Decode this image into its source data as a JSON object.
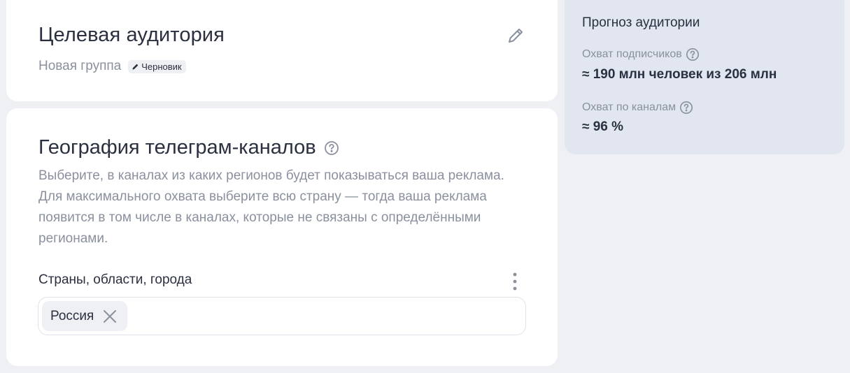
{
  "audience_card": {
    "title": "Целевая аудитория",
    "group_name": "Новая группа",
    "draft_badge": "Черновик",
    "edit_icon": "pencil-icon"
  },
  "geo_card": {
    "title": "География телеграм-каналов",
    "help_icon": "question-circle-icon",
    "description": "Выберите, в каналах из каких регионов будет показываться ваша реклама. Для максимального охвата выберите всю страну — тогда ваша реклама появится в том числе в каналах, которые не связаны с определёнными регионами.",
    "field_label": "Страны, области, города",
    "more_icon": "kebab-menu-icon",
    "selected_regions": [
      "Россия"
    ]
  },
  "forecast": {
    "title": "Прогноз аудитории",
    "subscribers_reach_label": "Охват подписчиков",
    "subscribers_reach_value": "≈ 190 млн человек из 206 млн",
    "channels_reach_label": "Охват по каналам",
    "channels_reach_value": "≈ 96 %"
  },
  "colors": {
    "background": "#eef0f4",
    "card": "#ffffff",
    "forecast_panel": "#e1e6f0",
    "text_primary": "#2b3040",
    "text_secondary": "#8a909e"
  }
}
